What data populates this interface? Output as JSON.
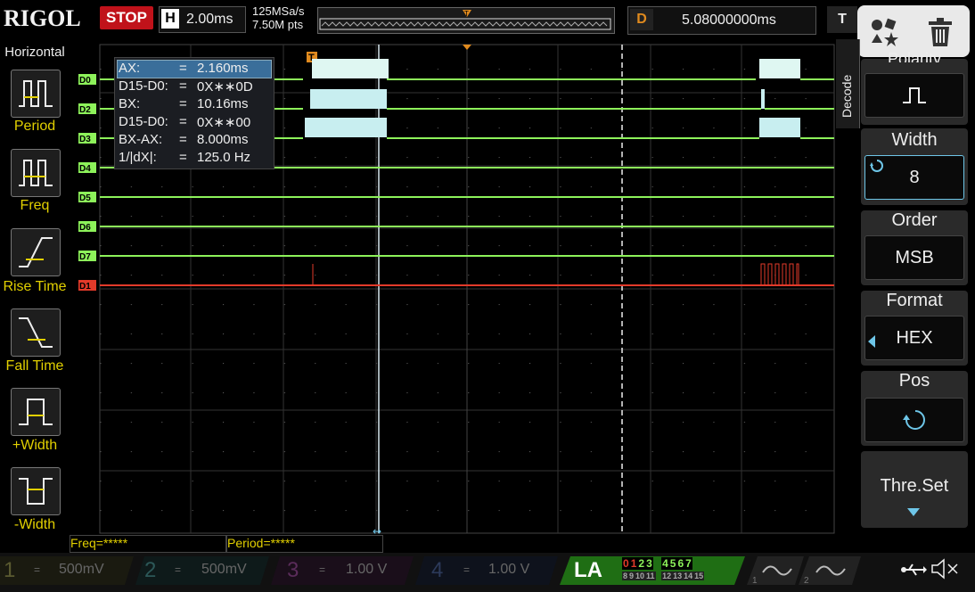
{
  "topbar": {
    "brand": "RIGOL",
    "run_state": "STOP",
    "h_label": "H",
    "h_value": "2.00ms",
    "sample_rate": "125MSa/s",
    "memory_depth": "7.50M pts",
    "delay_label": "D",
    "delay_value": "5.08000000ms",
    "trigger_label": "T"
  },
  "left_menu": {
    "title": "Horizontal",
    "items": [
      {
        "label": "Period",
        "icon": "period-icon"
      },
      {
        "label": "Freq",
        "icon": "freq-icon"
      },
      {
        "label": "Rise Time",
        "icon": "rise-time-icon"
      },
      {
        "label": "Fall Time",
        "icon": "fall-time-icon"
      },
      {
        "label": "+Width",
        "icon": "pos-width-icon"
      },
      {
        "label": "-Width",
        "icon": "neg-width-icon"
      }
    ]
  },
  "cursor_readout": {
    "rows": [
      {
        "k": "AX:",
        "v": "2.160ms"
      },
      {
        "k": "D15-D0:",
        "v": "0X∗∗0D"
      },
      {
        "k": "BX:",
        "v": "10.16ms"
      },
      {
        "k": "D15-D0:",
        "v": "0X∗∗00"
      },
      {
        "k": "BX-AX:",
        "v": "8.000ms"
      },
      {
        "k": "1/|dX|:",
        "v": "125.0 Hz"
      }
    ]
  },
  "channels": [
    "D0",
    "D2",
    "D3",
    "D4",
    "D5",
    "D6",
    "D7",
    "D1"
  ],
  "right_menu": {
    "tab": "Decode",
    "polarity_label": "Polarity",
    "width_label": "Width",
    "width_value": "8",
    "order_label": "Order",
    "order_value": "MSB",
    "format_label": "Format",
    "format_value": "HEX",
    "pos_label": "Pos",
    "threshold_label": "Thre.Set"
  },
  "measure": {
    "freq": "Freq=*****",
    "period": "Period=*****"
  },
  "bottom": {
    "ch1": {
      "num": "1",
      "value": "500mV"
    },
    "ch2": {
      "num": "2",
      "value": "500mV"
    },
    "ch3": {
      "num": "3",
      "value": "1.00 V"
    },
    "ch4": {
      "num": "4",
      "value": "1.00 V"
    },
    "la_label": "LA",
    "la_bits_top": [
      "0",
      "1",
      "2",
      "3",
      "4",
      "5",
      "6",
      "7"
    ],
    "la_bits_bottom": [
      "8",
      "9",
      "10",
      "11",
      "12",
      "13",
      "14",
      "15"
    ]
  },
  "colors": {
    "digital": "#8df25a",
    "selected": "#e23a2a",
    "accent": "#e2d000",
    "cursor": "#6ec6e8"
  }
}
